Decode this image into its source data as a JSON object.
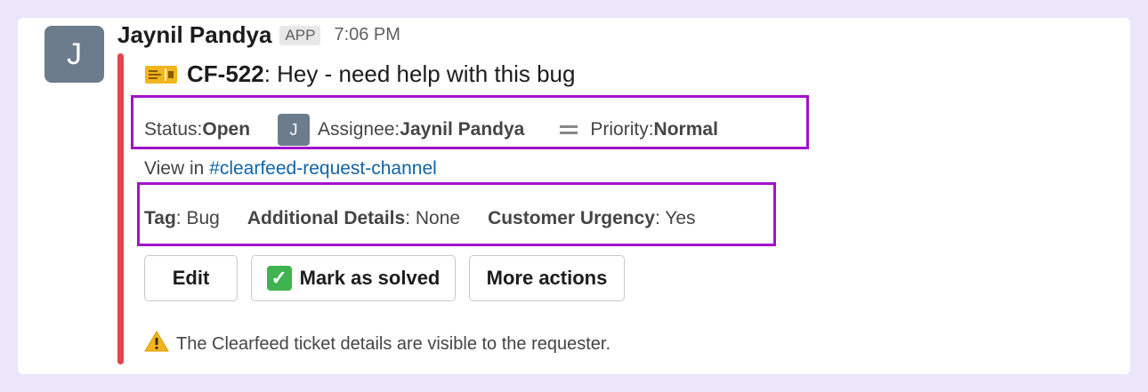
{
  "message": {
    "avatar_initial": "J",
    "sender": "Jaynil Pandya",
    "badge": "APP",
    "time": "7:06 PM",
    "accent_color": "#e8424a"
  },
  "ticket": {
    "id": "CF-522",
    "title_rest": ": Hey - need help with this bug",
    "status_label": "Status: ",
    "status_value": "Open",
    "assignee_initial": "J",
    "assignee_label": "Assignee: ",
    "assignee_value": "Jaynil Pandya",
    "priority_label": "Priority: ",
    "priority_value": "Normal",
    "view_prefix": "View in ",
    "channel_link": "#clearfeed-request-channel",
    "tag_label": "Tag",
    "tag_value": ": Bug",
    "details_label": "Additional Details",
    "details_value": ": None",
    "urgency_label": "Customer Urgency",
    "urgency_value": ": Yes"
  },
  "actions": {
    "edit": "Edit",
    "mark_solved": "Mark as solved",
    "more": "More actions"
  },
  "footer_note": "The Clearfeed ticket details are visible to the requester.",
  "highlight_color": "#a112c9"
}
